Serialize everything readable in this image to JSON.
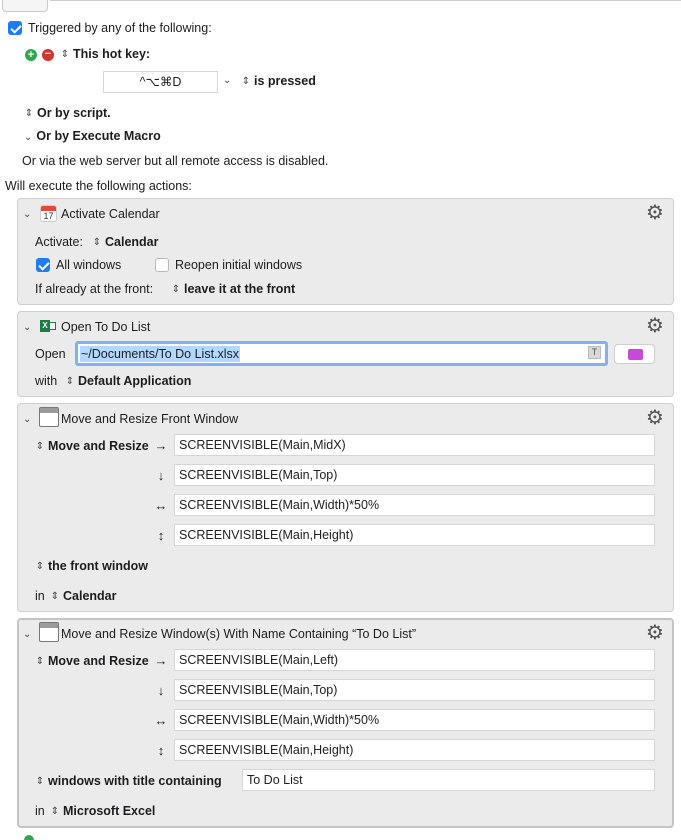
{
  "trigger": {
    "triggered_label": "Triggered by any of the following:",
    "hotkey_label": "This hot key:",
    "hotkey_value": "^⌥⌘D",
    "pressed_label": "is pressed",
    "or_script": "Or by script.",
    "or_execute": "Or by Execute Macro",
    "web_server": "Or via the web server but all remote access is disabled."
  },
  "will_execute": "Will execute the following actions:",
  "actions": [
    {
      "title": "Activate Calendar",
      "icon": "calendar-icon",
      "icon_day": "17",
      "activate_label": "Activate:",
      "activate_app": "Calendar",
      "all_windows": "All windows",
      "reopen": "Reopen initial windows",
      "front_label": "If already at the front:",
      "front_value": "leave it at the front"
    },
    {
      "title": "Open To Do List",
      "icon": "excel-icon",
      "open_label": "Open",
      "path": "~/Documents/To Do List.xlsx",
      "token_badge": "T",
      "with_label": "with",
      "with_value": "Default Application"
    },
    {
      "title": "Move and Resize Front Window",
      "icon": "window-icon",
      "mode": "Move and Resize",
      "arrows": [
        "→",
        "↓",
        "↔",
        "↕"
      ],
      "fields": [
        "SCREENVISIBLE(Main,MidX)",
        "SCREENVISIBLE(Main,Top)",
        "SCREENVISIBLE(Main,Width)*50%",
        "SCREENVISIBLE(Main,Height)"
      ],
      "target": "the front window",
      "in_label": "in",
      "in_app": "Calendar"
    },
    {
      "title": "Move and Resize Window(s) With Name Containing “To Do List”",
      "icon": "window-icon",
      "mode": "Move and Resize",
      "arrows": [
        "→",
        "↓",
        "↔",
        "↕"
      ],
      "fields": [
        "SCREENVISIBLE(Main,Left)",
        "SCREENVISIBLE(Main,Top)",
        "SCREENVISIBLE(Main,Width)*50%",
        "SCREENVISIBLE(Main,Height)"
      ],
      "target": "windows with title containing",
      "target_value": "To Do List",
      "in_label": "in",
      "in_app": "Microsoft Excel"
    }
  ],
  "colors": {
    "accent": "#1f7bf6",
    "add": "#2fa84f",
    "remove": "#d9312b",
    "panel": "#ebebeb",
    "selection": "#b3d7ff"
  }
}
